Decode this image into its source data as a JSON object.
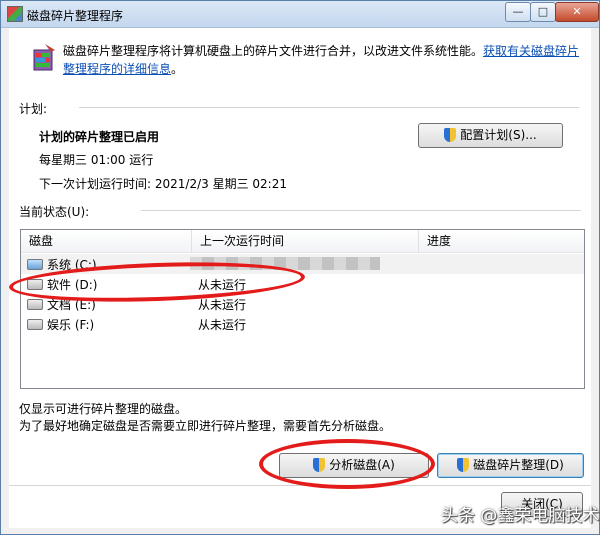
{
  "window": {
    "title": "磁盘碎片整理程序",
    "min_label": "—",
    "max_label": "□",
    "close_label": "✕"
  },
  "description": {
    "text": "磁盘碎片整理程序将计算机硬盘上的碎片文件进行合并，以改进文件系统性能。",
    "link_text": "获取有关磁盘碎片整理程序的详细信息",
    "link_suffix": "。"
  },
  "schedule": {
    "section_label": "计划:",
    "status": "计划的碎片整理已启用",
    "frequency": "每星期三  01:00 运行",
    "next_run": "下一次计划运行时间: 2021/2/3 星期三 02:21",
    "configure_button": "配置计划(S)..."
  },
  "current_status": {
    "section_label": "当前状态(U):",
    "columns": [
      "磁盘",
      "上一次运行时间",
      "进度"
    ],
    "rows": [
      {
        "disk": "系统 (C:)",
        "last_run": "",
        "progress": "",
        "icon": "system-drive-icon"
      },
      {
        "disk": "软件 (D:)",
        "last_run": "从未运行",
        "progress": "",
        "icon": "drive-icon"
      },
      {
        "disk": "文档 (E:)",
        "last_run": "从未运行",
        "progress": "",
        "icon": "drive-icon"
      },
      {
        "disk": "娱乐 (F:)",
        "last_run": "从未运行",
        "progress": "",
        "icon": "drive-icon"
      }
    ]
  },
  "notes": {
    "line1": "仅显示可进行碎片整理的磁盘。",
    "line2": "为了最好地确定磁盘是否需要立即进行碎片整理，需要首先分析磁盘。"
  },
  "buttons": {
    "analyze": "分析磁盘(A)",
    "defragment": "磁盘碎片整理(D)",
    "close": "关闭(C)"
  },
  "watermark": "头条 @鑫荣电脑技术",
  "colors": {
    "link": "#0a4fb5",
    "annotation_red": "#e41b1b",
    "shield_blue": "#2a6fd6",
    "shield_yellow": "#f2c230"
  }
}
